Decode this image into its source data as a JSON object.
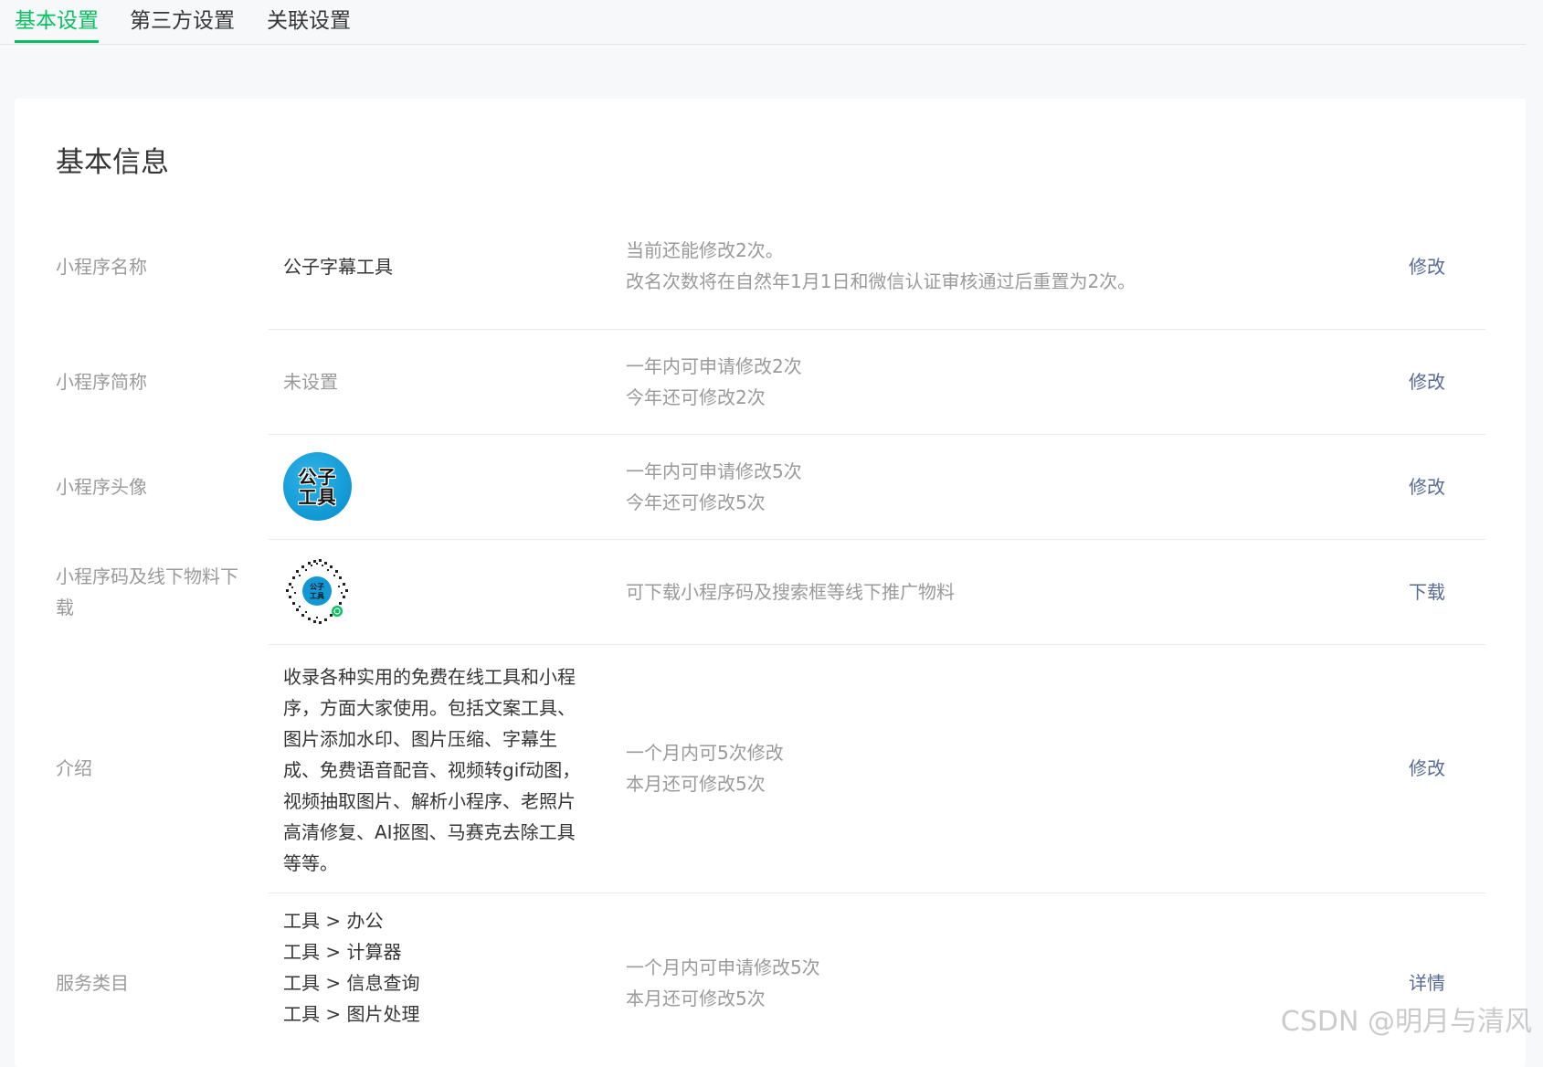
{
  "tabs": [
    {
      "label": "基本设置",
      "active": true
    },
    {
      "label": "第三方设置",
      "active": false
    },
    {
      "label": "关联设置",
      "active": false
    }
  ],
  "card": {
    "title": "基本信息"
  },
  "rows": {
    "name": {
      "label": "小程序名称",
      "value": "公子字幕工具",
      "tip1": "当前还能修改2次。",
      "tip2": "改名次数将在自然年1月1日和微信认证审核通过后重置为2次。",
      "action": "修改"
    },
    "short_name": {
      "label": "小程序简称",
      "value": "未设置",
      "tip1": "一年内可申请修改2次",
      "tip2": "今年还可修改2次",
      "action": "修改"
    },
    "avatar": {
      "label": "小程序头像",
      "avatar_text_line1": "公子",
      "avatar_text_line2": "工具",
      "tip1": "一年内可申请修改5次",
      "tip2": "今年还可修改5次",
      "action": "修改"
    },
    "qrcode": {
      "label": "小程序码及线下物料下载",
      "tip1": "可下载小程序码及搜索框等线下推广物料",
      "action": "下载"
    },
    "intro": {
      "label": "介绍",
      "value": "收录各种实用的免费在线工具和小程序，方面大家使用。包括文案工具、图片添加水印、图片压缩、字幕生成、免费语音配音、视频转gif动图，视频抽取图片、解析小程序、老照片高清修复、AI抠图、马赛克去除工具等等。",
      "tip1": "一个月内可5次修改",
      "tip2": "本月还可修改5次",
      "action": "修改"
    },
    "category": {
      "label": "服务类目",
      "values": [
        "工具 > 办公",
        "工具 > 计算器",
        "工具 > 信息查询",
        "工具 > 图片处理"
      ],
      "tip1": "一个月内可申请修改5次",
      "tip2": "本月还可修改5次",
      "action": "详情"
    }
  },
  "colors": {
    "accent": "#07c160",
    "link": "#576b95",
    "muted": "#9a9a9a",
    "avatar_bg": "#1198d4"
  },
  "watermark": "CSDN @明月与清风"
}
